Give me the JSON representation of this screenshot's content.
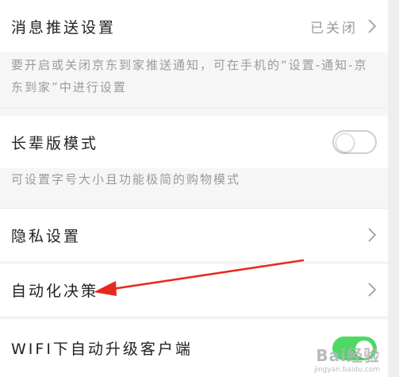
{
  "settings": {
    "push": {
      "title": "消息推送设置",
      "status": "已关闭",
      "description": "要开启或关闭京东到家推送通知，可在手机的“设置-通知-京东到家”中进行设置"
    },
    "elder_mode": {
      "title": "长辈版模式",
      "enabled": false,
      "description": "可设置字号大小且功能极简的购物模式"
    },
    "privacy": {
      "title": "隐私设置"
    },
    "auto_decision": {
      "title": "自动化决策"
    },
    "wifi_upgrade": {
      "title": "WIFI下自动升级客户端",
      "enabled": true
    }
  },
  "annotation": {
    "arrow_color": "#e8291f"
  },
  "watermark": {
    "brand": "Bai经验",
    "url": "jingyan.baidu.com"
  },
  "colors": {
    "toggle_on": "#4cd964",
    "toggle_off_border": "#cfcfcf",
    "arrow": "#e8291f"
  }
}
